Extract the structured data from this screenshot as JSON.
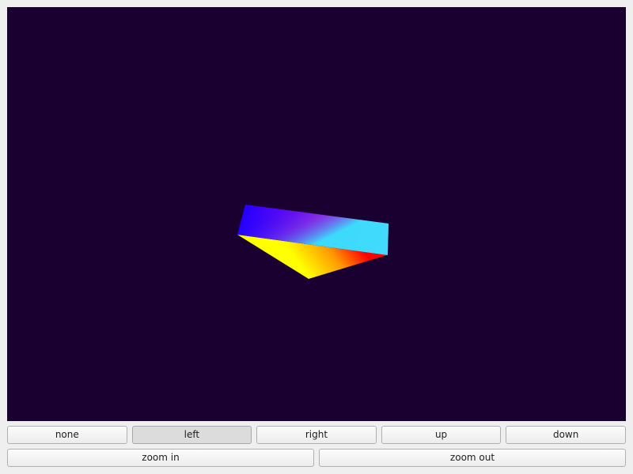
{
  "viewport": {
    "background": "#1a0030"
  },
  "controls": {
    "rotation_buttons": [
      {
        "id": "none",
        "label": "none",
        "active": false
      },
      {
        "id": "left",
        "label": "left",
        "active": true
      },
      {
        "id": "right",
        "label": "right",
        "active": false
      },
      {
        "id": "up",
        "label": "up",
        "active": false
      },
      {
        "id": "down",
        "label": "down",
        "active": false
      }
    ],
    "zoom_buttons": [
      {
        "id": "zoom-in",
        "label": "zoom in"
      },
      {
        "id": "zoom-out",
        "label": "zoom out"
      }
    ]
  }
}
